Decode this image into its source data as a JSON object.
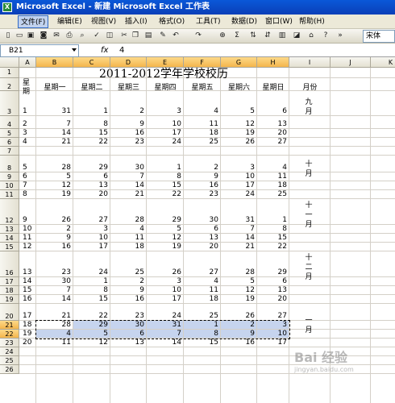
{
  "window": {
    "title": "Microsoft Excel - 新建 Microsoft Excel 工作表",
    "app_icon": "excel-icon"
  },
  "menu": [
    "文件(F)",
    "编辑(E)",
    "视图(V)",
    "插入(I)",
    "格式(O)",
    "工具(T)",
    "数据(D)",
    "窗口(W)",
    "帮助(H)"
  ],
  "toolbar": {
    "sum_symbol": "Σ",
    "font_name": "宋体"
  },
  "formula_bar": {
    "name_box": "B21",
    "fx": "fx",
    "value": "4"
  },
  "columns": [
    "A",
    "B",
    "C",
    "D",
    "E",
    "F",
    "G",
    "H",
    "I",
    "J",
    "K"
  ],
  "rows": [
    "1",
    "2",
    "3",
    "4",
    "5",
    "6",
    "7",
    "8",
    "9",
    "10",
    "11",
    "12",
    "13",
    "14",
    "15",
    "16",
    "17",
    "18",
    "19",
    "20",
    "21",
    "22",
    "23",
    "24",
    "25",
    "26"
  ],
  "sheet": {
    "title": "2011-2012学年学校校历",
    "headers": [
      "星期",
      "星期一",
      "星期二",
      "星期三",
      "星期四",
      "星期五",
      "星期六",
      "星期日",
      "月份"
    ],
    "months": [
      "九月",
      "十月",
      "十一月",
      "十二月",
      "一月"
    ],
    "data": [
      [
        "1",
        "31",
        "1",
        "2",
        "3",
        "4",
        "5",
        "6"
      ],
      [
        "2",
        "7",
        "8",
        "9",
        "10",
        "11",
        "12",
        "13"
      ],
      [
        "3",
        "14",
        "15",
        "16",
        "17",
        "18",
        "19",
        "20"
      ],
      [
        "4",
        "21",
        "22",
        "23",
        "24",
        "25",
        "26",
        "27"
      ],
      [
        "5",
        "28",
        "29",
        "30",
        "1",
        "2",
        "3",
        "4"
      ],
      [
        "6",
        "5",
        "6",
        "7",
        "8",
        "9",
        "10",
        "11"
      ],
      [
        "7",
        "12",
        "13",
        "14",
        "15",
        "16",
        "17",
        "18"
      ],
      [
        "8",
        "19",
        "20",
        "21",
        "22",
        "23",
        "24",
        "25"
      ],
      [
        "9",
        "26",
        "27",
        "28",
        "29",
        "30",
        "31",
        "1"
      ],
      [
        "10",
        "2",
        "3",
        "4",
        "5",
        "6",
        "7",
        "8"
      ],
      [
        "11",
        "9",
        "10",
        "11",
        "12",
        "13",
        "14",
        "15"
      ],
      [
        "12",
        "16",
        "17",
        "18",
        "19",
        "20",
        "21",
        "22"
      ],
      [
        "13",
        "23",
        "24",
        "25",
        "26",
        "27",
        "28",
        "29"
      ],
      [
        "14",
        "30",
        "1",
        "2",
        "3",
        "4",
        "5",
        "6"
      ],
      [
        "15",
        "7",
        "8",
        "9",
        "10",
        "11",
        "12",
        "13"
      ],
      [
        "16",
        "14",
        "15",
        "16",
        "17",
        "18",
        "19",
        "20"
      ],
      [
        "17",
        "21",
        "22",
        "23",
        "24",
        "25",
        "26",
        "27"
      ],
      [
        "18",
        "28",
        "29",
        "30",
        "31",
        "1",
        "2",
        "3"
      ],
      [
        "19",
        "4",
        "5",
        "6",
        "7",
        "8",
        "9",
        "10"
      ],
      [
        "20",
        "11",
        "12",
        "13",
        "14",
        "15",
        "16",
        "17"
      ]
    ]
  },
  "watermark": {
    "text": "Bai 经验",
    "sub": "jingyan.baidu.com"
  }
}
